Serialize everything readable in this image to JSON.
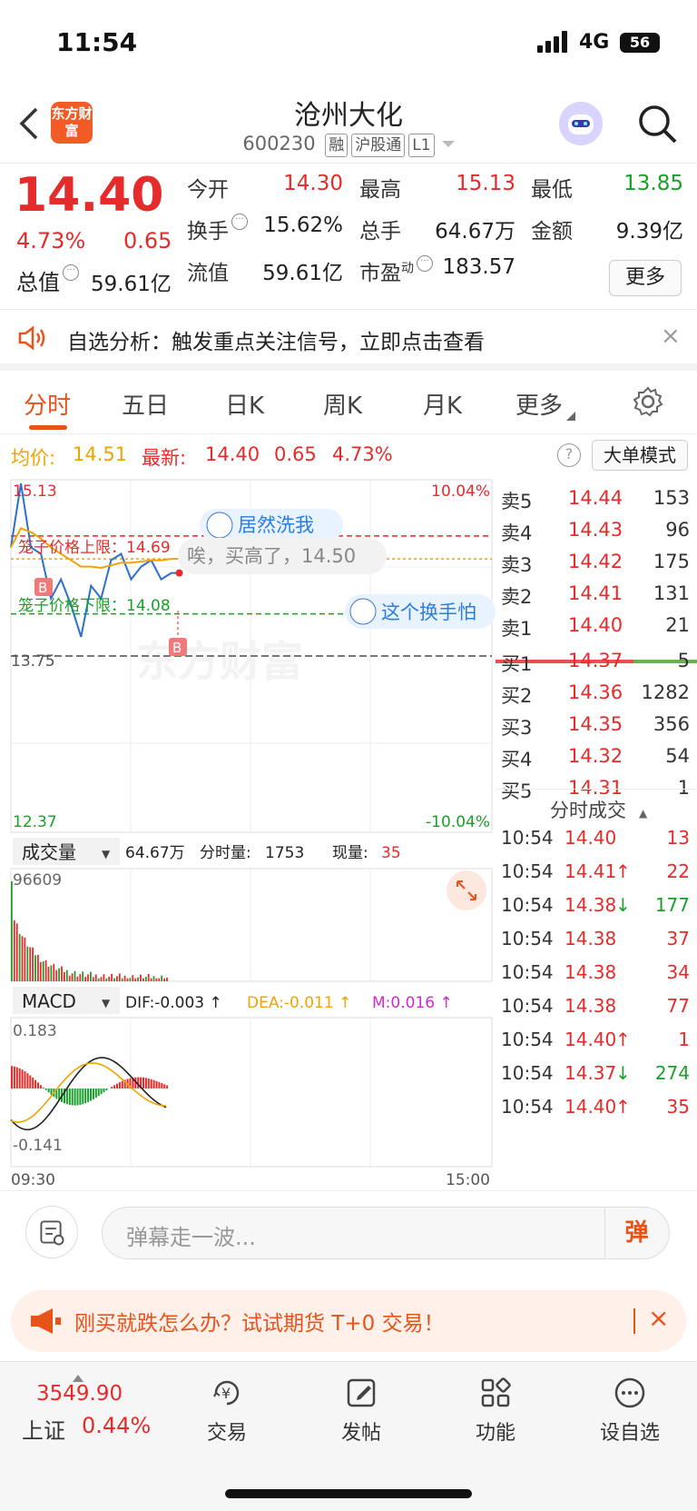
{
  "status_bar": {
    "time": "11:54",
    "network": "4G",
    "battery": "56"
  },
  "header": {
    "logo_text": "东方财富",
    "stock_name": "沧州大化",
    "stock_code": "600230",
    "tags": [
      "融",
      "沪股通",
      "L1"
    ]
  },
  "quote": {
    "price": "14.40",
    "change_pct": "4.73%",
    "change": "0.65",
    "market_cap_label": "总值",
    "market_cap": "59.61亿",
    "open_label": "今开",
    "open": "14.30",
    "high_label": "最高",
    "high": "15.13",
    "low_label": "最低",
    "low": "13.85",
    "turnover_label": "换手",
    "turnover": "15.62%",
    "volume_label": "总手",
    "volume": "64.67万",
    "amount_label": "金额",
    "amount": "9.39亿",
    "float_label": "流值",
    "float_cap": "59.61亿",
    "pe_label": "市盈",
    "pe_sup": "动",
    "pe": "183.57",
    "more_button": "更多"
  },
  "alert": {
    "text": "自选分析：触发重点关注信号，立即点击查看",
    "close": "×"
  },
  "tabs": [
    "分时",
    "五日",
    "日K",
    "周K",
    "月K",
    "更多"
  ],
  "summary": {
    "avg_label": "均价:",
    "avg": "14.51",
    "latest_label": "最新:",
    "latest": "14.40",
    "change": "0.65",
    "change_pct": "4.73%",
    "help": "?",
    "mode_button": "大单模式"
  },
  "chart_labels": {
    "top_price": "15.13",
    "top_pct": "10.04%",
    "bottom_price": "12.37",
    "bottom_pct": "-10.04%",
    "prev_close": "13.75",
    "upper_limit_label": "笼子价格上限：14.69",
    "lower_limit_label": "笼子价格下限：14.08",
    "danmaku": [
      "居然洗我",
      "唉，买高了，14.50",
      "这个换手怕"
    ],
    "marker_b": "B",
    "watermark": "东方财富"
  },
  "chart_data": {
    "type": "line",
    "title": "",
    "ylim": [
      12.37,
      15.13
    ],
    "prev_close": 13.75,
    "upper_limit": 14.69,
    "lower_limit": 14.08,
    "x": [
      "09:30",
      "09:35",
      "09:40",
      "09:45",
      "09:50",
      "09:55",
      "10:00",
      "10:05",
      "10:10",
      "10:15",
      "10:20",
      "10:25",
      "10:30",
      "10:35",
      "10:40",
      "10:45",
      "10:50",
      "10:54"
    ],
    "series": [
      {
        "name": "",
        "color": "#2b6fd0",
        "values": [
          14.6,
          15.1,
          14.6,
          14.55,
          14.2,
          14.35,
          14.15,
          13.9,
          14.3,
          14.2,
          14.5,
          14.55,
          14.35,
          14.45,
          14.5,
          14.35,
          14.4,
          14.4
        ]
      },
      {
        "name": "均价",
        "color": "#f0a400",
        "values": [
          14.6,
          14.75,
          14.72,
          14.67,
          14.6,
          14.55,
          14.5,
          14.45,
          14.45,
          14.44,
          14.46,
          14.48,
          14.48,
          14.49,
          14.5,
          14.5,
          14.51,
          14.51
        ]
      }
    ],
    "volume": {
      "label": "成交量",
      "total": "64.67万",
      "interval_label": "分时量:",
      "interval": "1753",
      "now_label": "现量:",
      "now": "35",
      "max_label": "96609"
    },
    "macd": {
      "label": "MACD",
      "dif_label": "DIF:",
      "dif": "-0.003",
      "dea_label": "DEA:",
      "dea": "-0.011",
      "m_label": "M:",
      "m": "0.016",
      "max_label": "0.183",
      "min_label": "-0.141"
    },
    "time_start": "09:30",
    "time_end": "15:00"
  },
  "order_book": {
    "asks": [
      {
        "label": "卖5",
        "price": "14.44",
        "vol": "153"
      },
      {
        "label": "卖4",
        "price": "14.43",
        "vol": "96"
      },
      {
        "label": "卖3",
        "price": "14.42",
        "vol": "175"
      },
      {
        "label": "卖2",
        "price": "14.41",
        "vol": "131"
      },
      {
        "label": "卖1",
        "price": "14.40",
        "vol": "21"
      }
    ],
    "bids": [
      {
        "label": "买1",
        "price": "14.37",
        "vol": "5"
      },
      {
        "label": "买2",
        "price": "14.36",
        "vol": "1282"
      },
      {
        "label": "买3",
        "price": "14.35",
        "vol": "356"
      },
      {
        "label": "买4",
        "price": "14.32",
        "vol": "54"
      },
      {
        "label": "买5",
        "price": "14.31",
        "vol": "1"
      }
    ]
  },
  "ticks": {
    "header": "分时成交",
    "rows": [
      {
        "time": "10:54",
        "price": "14.40",
        "dir": "",
        "vol": "13"
      },
      {
        "time": "10:54",
        "price": "14.41",
        "dir": "↑",
        "vol": "22"
      },
      {
        "time": "10:54",
        "price": "14.38",
        "dir": "↓",
        "vol": "177"
      },
      {
        "time": "10:54",
        "price": "14.38",
        "dir": "",
        "vol": "37"
      },
      {
        "time": "10:54",
        "price": "14.38",
        "dir": "",
        "vol": "34"
      },
      {
        "time": "10:54",
        "price": "14.38",
        "dir": "",
        "vol": "77"
      },
      {
        "time": "10:54",
        "price": "14.40",
        "dir": "↑",
        "vol": "1"
      },
      {
        "time": "10:54",
        "price": "14.37",
        "dir": "↓",
        "vol": "274"
      },
      {
        "time": "10:54",
        "price": "14.40",
        "dir": "↑",
        "vol": "35"
      }
    ]
  },
  "danmu_bar": {
    "placeholder": "弹幕走一波...",
    "send": "弹"
  },
  "promo": {
    "text": "刚买就跌怎么办？试试期货 T+0 交易！",
    "close": "×"
  },
  "bottom_nav": {
    "index_value": "3549.90",
    "index_name": "上证",
    "index_pct": "0.44%",
    "items": [
      "交易",
      "发帖",
      "功能",
      "设自选"
    ]
  }
}
